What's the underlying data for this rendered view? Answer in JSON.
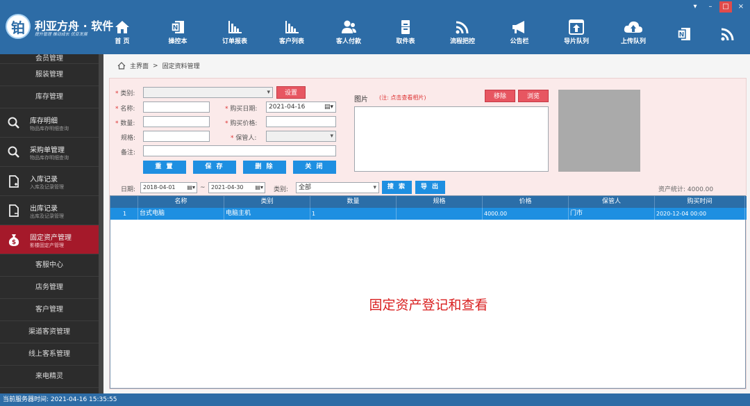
{
  "app": {
    "logo_char": "铂",
    "name": "利亚方舟 · 软件",
    "slogan": "提升管理 推动成长 优亚发展"
  },
  "toolbar": {
    "items": [
      {
        "label": "首 页",
        "icon": "home-icon"
      },
      {
        "label": "操控本",
        "icon": "notebook-icon"
      },
      {
        "label": "订单报表",
        "icon": "bar-chart-icon"
      },
      {
        "label": "客户列表",
        "icon": "bar-chart-icon"
      },
      {
        "label": "客人付款",
        "icon": "users-icon"
      },
      {
        "label": "取件表",
        "icon": "cabinet-icon"
      },
      {
        "label": "流程把控",
        "icon": "signal-icon"
      },
      {
        "label": "公告栏",
        "icon": "megaphone-icon"
      },
      {
        "label": "导片队列",
        "icon": "upload-window-icon"
      },
      {
        "label": "上传队列",
        "icon": "cloud-upload-icon"
      }
    ]
  },
  "window_controls": {
    "menu": "▾",
    "minimize": "–",
    "maximize": "□",
    "close": "×"
  },
  "sidebar": {
    "items": [
      {
        "title": "会员管理"
      },
      {
        "title": "服装管理"
      },
      {
        "title": "库存管理"
      },
      {
        "title": "库存明细",
        "subtitle": "物品库存明细查询",
        "icon": "search-icon"
      },
      {
        "title": "采购单管理",
        "subtitle": "物品库存明细查询",
        "icon": "search-icon"
      },
      {
        "title": "入库记录",
        "subtitle": "入库及记录管理",
        "icon": "document-in-icon"
      },
      {
        "title": "出库记录",
        "subtitle": "出库及记录管理",
        "icon": "document-out-icon"
      },
      {
        "title": "固定资产管理",
        "subtitle": "影楼固定产管理",
        "icon": "money-bag-icon",
        "active": true
      },
      {
        "title": "客服中心"
      },
      {
        "title": "店务管理"
      },
      {
        "title": "客户管理"
      },
      {
        "title": "渠道客资管理"
      },
      {
        "title": "线上客系管理"
      },
      {
        "title": "来电精灵"
      }
    ]
  },
  "breadcrumb": {
    "home": "主界面",
    "sep": ">",
    "current": "固定资料管理"
  },
  "form": {
    "category_label": "类别:",
    "category_value": "",
    "setup_button": "设置",
    "name_label": "名称:",
    "name_value": "",
    "purchase_date_label": "购买日期:",
    "purchase_date_value": "2021-04-16",
    "quantity_label": "数量:",
    "quantity_value": "",
    "purchase_price_label": "购买价格:",
    "purchase_price_value": "",
    "spec_label": "规格:",
    "spec_value": "",
    "keeper_label": "保管人:",
    "keeper_value": "",
    "remark_label": "备注:",
    "remark_value": "",
    "required_mark": "*",
    "buttons": {
      "reset": "重 置",
      "save": "保 存",
      "delete": "删 除",
      "close": "关 闭"
    }
  },
  "photo": {
    "label": "图片",
    "note": "(注: 点击查看相片)",
    "remove_button": "移除",
    "browse_button": "浏览"
  },
  "filter": {
    "date_label": "日期:",
    "date_from": "2018-04-01",
    "date_sep": "~",
    "date_to": "2021-04-30",
    "category_label": "类别:",
    "category_value": "全部",
    "search_button": "搜 索",
    "export_button": "导 出",
    "asset_total": "资产统计: 4000.00"
  },
  "table": {
    "headers": [
      "名称",
      "类别",
      "数量",
      "规格",
      "价格",
      "保管人",
      "购买时间"
    ],
    "rows": [
      {
        "index": "1",
        "name": "台式电脑",
        "category": "电脑主机",
        "qty": "1",
        "spec": "",
        "price": "4000.00",
        "keeper": "门市",
        "date": "2020-12-04 00:00"
      }
    ]
  },
  "watermark": "固定资产登记和查看",
  "status": {
    "server_time": "当前服务器时间: 2021-04-16 15:35:55"
  },
  "colors": {
    "topbar": "#2d6ca6",
    "sidebar": "#2c2c2c",
    "sidebar_active": "#a5192a",
    "accent_blue": "#1e8fe1",
    "accent_red": "#e75661",
    "panel_bg": "#fbeaea",
    "watermark": "#d91f1f"
  }
}
